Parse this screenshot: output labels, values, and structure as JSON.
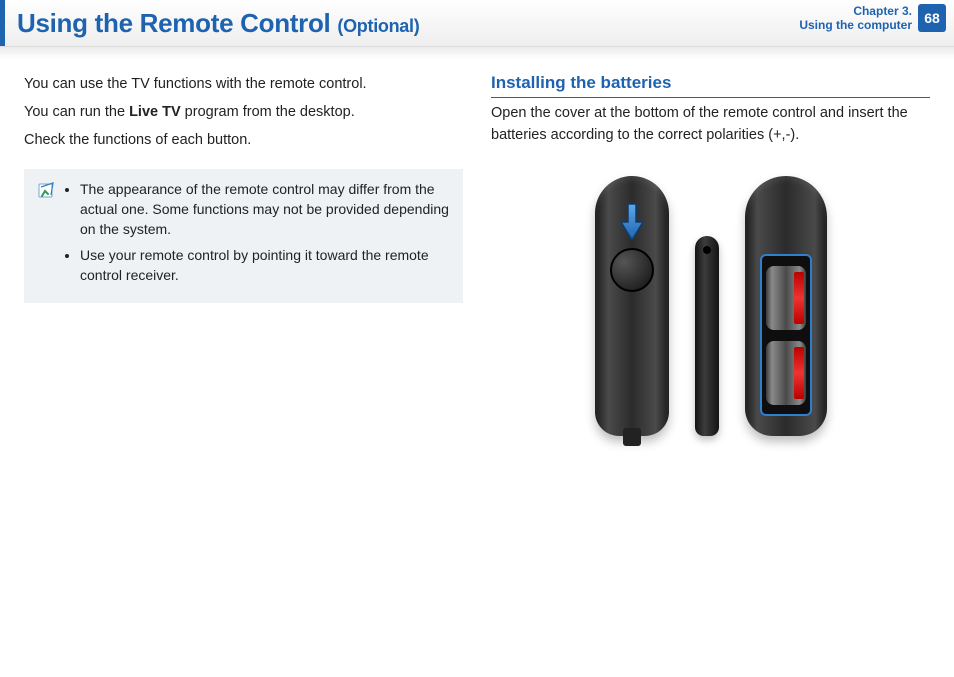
{
  "header": {
    "title_main": "Using the Remote Control ",
    "title_suffix": "(Optional)",
    "chapter_line1": "Chapter 3.",
    "chapter_line2": "Using the computer",
    "page_number": "68"
  },
  "left": {
    "p1": "You can use the TV functions with the remote control.",
    "p2a": "You can run the ",
    "p2b": "Live TV",
    "p2c": " program from the desktop.",
    "p3": "Check the functions of each button.",
    "note1": "The appearance of the remote control may differ from the actual one. Some functions may not be provided depending on the system.",
    "note2": "Use your remote control by pointing it toward the remote control receiver."
  },
  "right": {
    "section_title": "Installing the batteries",
    "p1": "Open the cover at the bottom of the remote control and insert the batteries according to the correct polarities (+,-)."
  }
}
